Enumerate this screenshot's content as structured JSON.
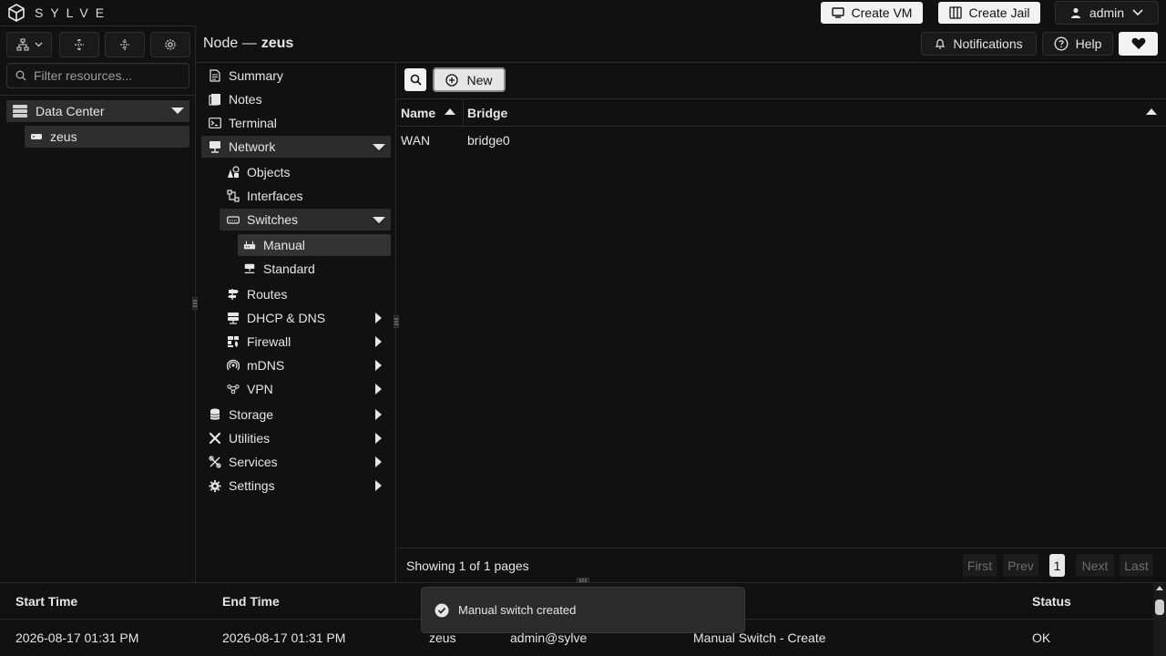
{
  "header": {
    "logo_text": "SYLVE",
    "create_vm": "Create VM",
    "create_jail": "Create Jail",
    "user": "admin"
  },
  "left": {
    "filter_placeholder": "Filter resources...",
    "tree": [
      {
        "label": "Data Center"
      },
      {
        "label": "zeus"
      }
    ]
  },
  "breadcrumb": {
    "prefix": "Node —",
    "node": "zeus"
  },
  "top_actions": {
    "notifications": "Notifications",
    "help": "Help"
  },
  "nav": {
    "summary": "Summary",
    "notes": "Notes",
    "terminal": "Terminal",
    "network": "Network",
    "objects": "Objects",
    "interfaces": "Interfaces",
    "switches": "Switches",
    "manual": "Manual",
    "standard": "Standard",
    "routes": "Routes",
    "dhcp": "DHCP & DNS",
    "firewall": "Firewall",
    "mdns": "mDNS",
    "vpn": "VPN",
    "storage": "Storage",
    "utilities": "Utilities",
    "services": "Services",
    "settings": "Settings"
  },
  "toolbar": {
    "new_label": "New"
  },
  "table": {
    "columns": [
      "Name",
      "Bridge"
    ],
    "rows": [
      {
        "name": "WAN",
        "bridge": "bridge0"
      }
    ]
  },
  "pagination": {
    "summary": "Showing 1 of 1 pages",
    "first": "First",
    "prev": "Prev",
    "page": "1",
    "next": "Next",
    "last": "Last"
  },
  "tasks": {
    "columns": {
      "start": "Start Time",
      "end": "End Time",
      "status": "Status"
    },
    "rows": [
      {
        "start": "2026-08-17 01:31 PM",
        "end": "2026-08-17 01:31 PM",
        "node": "zeus",
        "user": "admin@sylve",
        "description": "Manual Switch - Create",
        "status": "OK"
      }
    ]
  },
  "toast": {
    "message": "Manual switch created"
  }
}
